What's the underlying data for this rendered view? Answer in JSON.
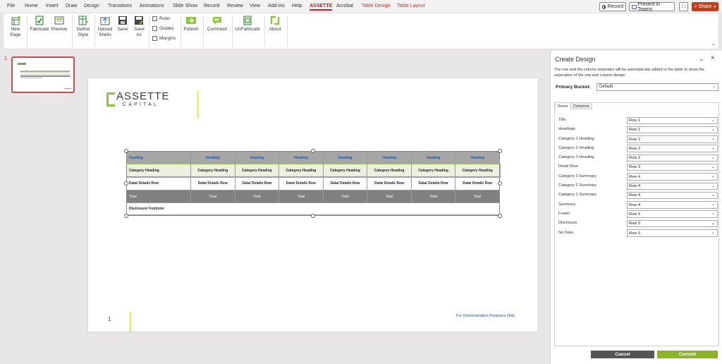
{
  "menu": {
    "tabs": [
      "File",
      "Home",
      "Insert",
      "Draw",
      "Design",
      "Transitions",
      "Animations",
      "Slide Show",
      "Record",
      "Review",
      "View",
      "Add-ins",
      "Help",
      "ASSETTE",
      "Acrobat",
      "Table Design",
      "Table Layout"
    ],
    "record_label": "Record",
    "teams_label": "Present in Teams",
    "share_label": "Share"
  },
  "ribbon": {
    "new_page": "New Page",
    "fabricate": "Fabricate",
    "preview": "Preview",
    "define_style": "Define Style",
    "upload_shells": "Upload Shells",
    "save": "Save",
    "save_as": "Save As",
    "ruler": "Ruler",
    "guides": "Guides",
    "margins": "Margins",
    "publish": "Publish",
    "comment": "Comment",
    "unfabricate": "UnFabricate",
    "about": "About"
  },
  "thumbnails": {
    "slide_number": "1"
  },
  "slide": {
    "logo_name": "ASSETTE",
    "logo_sub": "CAPITAL",
    "page_number": "1",
    "demo_note": "For Demonstration Purposes Only",
    "table": {
      "heading": [
        "Heading",
        "Heading",
        "Heading",
        "Heading",
        "Heading",
        "Heading",
        "Heading",
        "Heading"
      ],
      "category": [
        "Category Heading",
        "Category Heading",
        "Category Heading",
        "Category Heading",
        "Category Heading",
        "Category Heading",
        "Category Heading",
        "Category Heading"
      ],
      "detail": [
        "Data/ Details Row",
        "Data/ Details Row",
        "Data/ Details Row",
        "Data/ Details Row",
        "Data/ Details Row",
        "Data/ Details Row",
        "Data/ Details Row",
        "Data/ Details Row"
      ],
      "total": [
        "Total",
        "Total",
        "Total",
        "Total",
        "Total",
        "Total",
        "Total",
        "Total"
      ],
      "disclosure": "Disclosure/ Footnote"
    }
  },
  "panel": {
    "title": "Create Design",
    "description": "The row and the column seperator will be automatically added to the table to show the seperation of the row and column design",
    "primary_bucket_label": "Primary Bucket:",
    "primary_bucket_value": "Default",
    "tab_rows": "Rows",
    "tab_columns": "Columns",
    "rows": [
      {
        "label": "Title",
        "value": "Row 1"
      },
      {
        "label": "Headings",
        "value": "Row 1"
      },
      {
        "label": "Category 1 Heading",
        "value": "Row 2"
      },
      {
        "label": "Category 2 Heading",
        "value": "Row 2"
      },
      {
        "label": "Category 3 Heading",
        "value": "Row 2"
      },
      {
        "label": "Detail Row",
        "value": "Row 3"
      },
      {
        "label": "Category 3 Summary",
        "value": "Row 4"
      },
      {
        "label": "Category 2 Summary",
        "value": "Row 4"
      },
      {
        "label": "Category 1 Summary",
        "value": "Row 4"
      },
      {
        "label": "Summary",
        "value": "Row 4"
      },
      {
        "label": "Footer",
        "value": "Row 5"
      },
      {
        "label": "Disclosure",
        "value": "Row 5"
      },
      {
        "label": "No Data",
        "value": "Row 5"
      }
    ],
    "cancel_label": "Cancel",
    "commit_label": "Commit"
  },
  "colors": {
    "accent_red": "#b7252d",
    "brand_green": "#8cc63f",
    "commit_green": "#8cb32a",
    "heading_blue": "#1f5fa8"
  }
}
